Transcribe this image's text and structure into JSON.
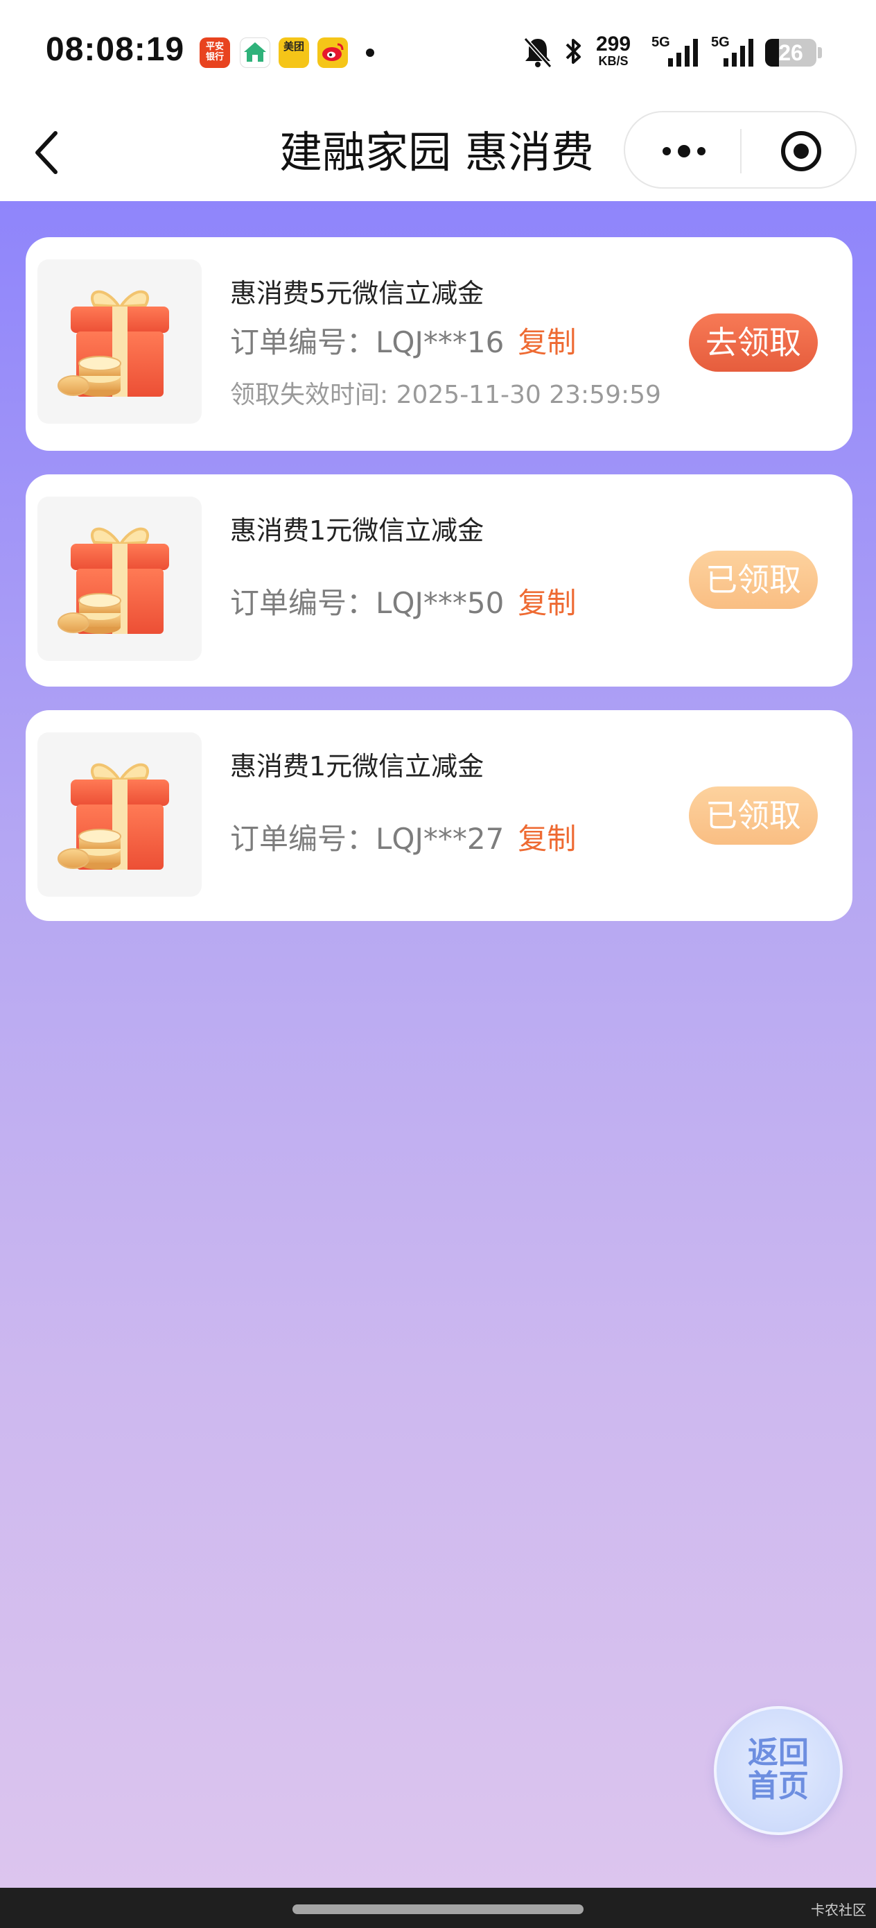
{
  "status_bar": {
    "time": "08:08:19",
    "apps": [
      {
        "name": "平安银行",
        "line1": "平安",
        "line2": "银行",
        "color": "#e8431f"
      },
      {
        "name": "home-app",
        "color": "#ffffff",
        "icon": "house-icon"
      },
      {
        "name": "美团",
        "line1": "美团",
        "line2": "",
        "color": "#f5c518"
      },
      {
        "name": "微博",
        "icon": "weibo-icon",
        "color": "#f5c518"
      }
    ],
    "speed_value": "299",
    "speed_unit": "KB/S",
    "signal1_label": "5G",
    "signal2_label": "5G",
    "battery_level": "26"
  },
  "nav": {
    "title": "建融家园 惠消费"
  },
  "coupons": [
    {
      "title": "惠消费5元微信立减金",
      "order_label": "订单编号：",
      "order_no": "LQJ***16",
      "copy_label": "复制",
      "expire": "领取失效时间: 2025-11-30 23:59:59",
      "button": "去领取",
      "status": "active"
    },
    {
      "title": "惠消费1元微信立减金",
      "order_label": "订单编号：",
      "order_no": "LQJ***50",
      "copy_label": "复制",
      "button": "已领取",
      "status": "claimed"
    },
    {
      "title": "惠消费1元微信立减金",
      "order_label": "订单编号：",
      "order_no": "LQJ***27",
      "copy_label": "复制",
      "button": "已领取",
      "status": "claimed"
    }
  ],
  "home_button": {
    "line1": "返回",
    "line2": "首页"
  },
  "watermark": "卡农社区",
  "colors": {
    "accent": "#ee6a32",
    "active_button": "#ec6646",
    "claimed_button": "#fbc98f",
    "background_top": "#8f85fb",
    "background_bottom": "#dcc5ee"
  }
}
